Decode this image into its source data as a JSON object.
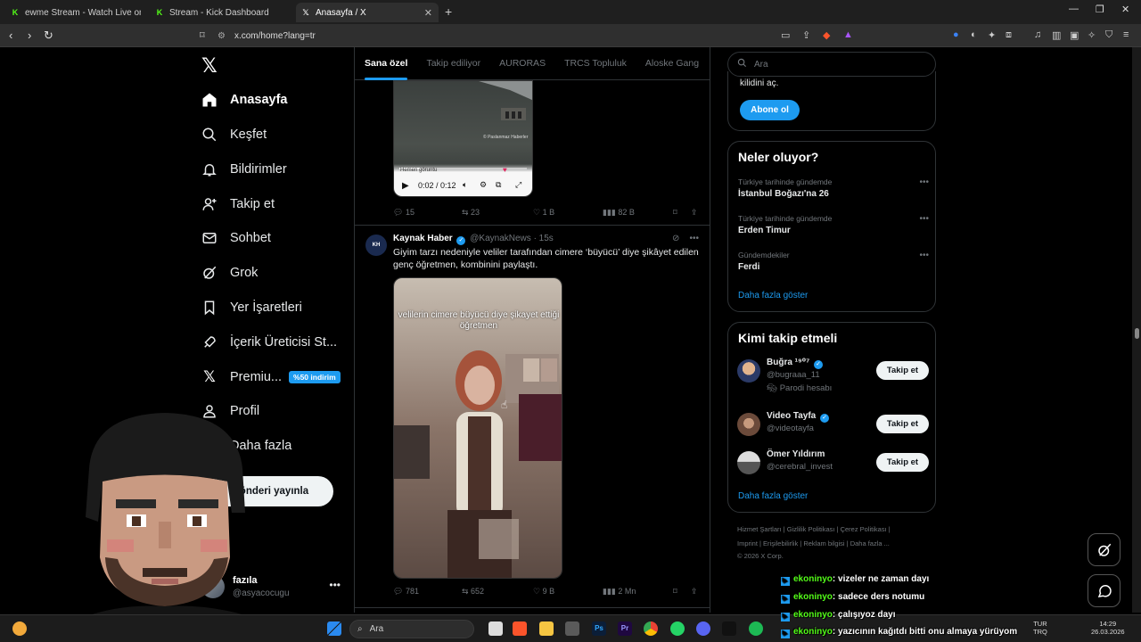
{
  "browser": {
    "tabs": [
      {
        "title": "ewme Stream - Watch Live on Ki...",
        "favicon": "kick-icon",
        "active": false
      },
      {
        "title": "Stream - Kick Dashboard",
        "favicon": "kick-icon",
        "active": false
      },
      {
        "title": "Anasayfa / X",
        "favicon": "x-icon",
        "active": true
      }
    ],
    "url": "x.com/home?lang=tr"
  },
  "nav": {
    "items": [
      {
        "label": "Anasayfa",
        "icon": "home-icon",
        "active": true
      },
      {
        "label": "Keşfet",
        "icon": "search-icon"
      },
      {
        "label": "Bildirimler",
        "icon": "bell-icon"
      },
      {
        "label": "Takip et",
        "icon": "add-user-icon"
      },
      {
        "label": "Sohbet",
        "icon": "mail-icon"
      },
      {
        "label": "Grok",
        "icon": "grok-icon"
      },
      {
        "label": "Yer İşaretleri",
        "icon": "bookmark-icon"
      },
      {
        "label": "İçerik Üreticisi St...",
        "icon": "rocket-icon"
      },
      {
        "label": "Premiu...",
        "icon": "x-icon",
        "badge": "%50 indirim"
      },
      {
        "label": "Profil",
        "icon": "profile-icon"
      },
      {
        "label": "Daha fazla",
        "icon": "more-icon"
      }
    ],
    "post_button": "Gönderi yayınla",
    "account": {
      "name": "fazıla",
      "handle": "@asyacocugu"
    }
  },
  "feed": {
    "tabs": [
      "Sana özel",
      "Takip ediliyor",
      "AURORAS",
      "TRCS Topluluk",
      "Aloske Gang"
    ],
    "post1": {
      "video_time": "0:02 / 0:12",
      "progress": 0.17,
      "watermark": "© Paslanmaz Haberler",
      "mini_caption": "Hemen göruntu",
      "replies": "15",
      "reposts": "23",
      "likes": "1 B",
      "views": "82 B"
    },
    "post2": {
      "name": "Kaynak Haber",
      "handle": "@KaynakNews",
      "time": "· 15s",
      "text": "Giyim tarzı nedeniyle veliler tarafından cimere ‘büyücü’ diye şikâyet edilen genç öğretmen, kombinini paylaştı.",
      "video_caption": "velilerin cimere büyücü diye şikayet ettiği öğretmen",
      "replies": "781",
      "reposts": "652",
      "likes": "9 B",
      "views": "2 Mn"
    }
  },
  "sidebar": {
    "search_placeholder": "Ara",
    "premium": {
      "text": "kilidini aç.",
      "button": "Abone ol"
    },
    "trends_title": "Neler oluyor?",
    "trends": [
      {
        "context": "Türkiye tarihinde gündemde",
        "name": "İstanbul Boğazı'na 26"
      },
      {
        "context": "Türkiye tarihinde gündemde",
        "name": "Erden Timur"
      },
      {
        "context": "Gündemdekiler",
        "name": "Ferdi"
      }
    ],
    "show_more": "Daha fazla göster",
    "who_title": "Kimi takip etmeli",
    "who": [
      {
        "name": "Buğra ¹⁹⁰⁷",
        "handle": "@bugraaa_11",
        "extra": "Parodi hesabı",
        "button": "Takip et"
      },
      {
        "name": "Video Tayfa",
        "handle": "@videotayfa",
        "button": "Takip et"
      },
      {
        "name": "Ömer Yıldırım",
        "handle": "@cerebral_invest",
        "button": "Takip et"
      }
    ],
    "footer_line1": "Hizmet Şartları  |  Gizlilik Politikası  |  Çerez Politikası  |",
    "footer_line2": "Imprint  |  Erişilebilirlik  |  Reklam bilgisi  |  Daha fazla ...",
    "footer_line3": "© 2026 X Corp."
  },
  "chat": [
    {
      "user": "ekoninyo",
      "msg": ": vizeler ne zaman dayı"
    },
    {
      "user": "ekoninyo",
      "msg": ": sadece ders notumu"
    },
    {
      "user": "ekoninyo",
      "msg": ": çalışıyoz dayı"
    },
    {
      "user": "ekoninyo",
      "msg": ": yazıcının kağıtdı bitti onu almaya yürüyom"
    }
  ],
  "taskbar": {
    "search": "Ara",
    "lang": "TUR",
    "lang2": "TRQ",
    "time": "14:29",
    "date": "26.03.2026"
  }
}
